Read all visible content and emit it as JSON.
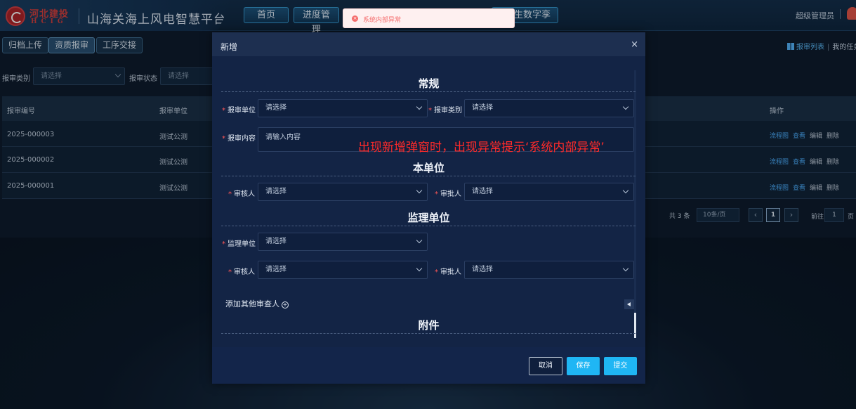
{
  "header": {
    "logo_cn": "河北建投",
    "logo_en": "HCIG",
    "app_title": "山海关海上风电智慧平台",
    "nav": {
      "home": "首页",
      "progress": "进度管理",
      "digital_twin": "孪生数字孪生"
    },
    "user": "超级管理员"
  },
  "subtabs": {
    "archive": "归档上传",
    "qualification": "资质报审",
    "handover": "工序交接"
  },
  "right_links": {
    "report_list": "报审列表",
    "my_tasks": "我的任务"
  },
  "filters": {
    "type_label": "报审类别",
    "type_placeholder": "请选择",
    "status_label": "报审状态",
    "status_placeholder": "请选择"
  },
  "table": {
    "headers": {
      "code": "报审编号",
      "unit": "报审单位",
      "ops": "操作"
    },
    "rows": [
      {
        "code": "2025-000003",
        "unit": "测试公测"
      },
      {
        "code": "2025-000002",
        "unit": "测试公测"
      },
      {
        "code": "2025-000001",
        "unit": "测试公测"
      }
    ],
    "ops": {
      "flow": "流程图",
      "view": "查看",
      "edit": "编辑",
      "delete": "删除"
    }
  },
  "pager": {
    "total": "共 3 条",
    "size": "10条/页",
    "current": "1",
    "goto": "前往",
    "goto_value": "1",
    "page": "页",
    "prev": "‹",
    "next": "›"
  },
  "dialog": {
    "title": "新增",
    "close": "×",
    "sections": {
      "general": "常规",
      "own_unit": "本单位",
      "supervision": "监理单位",
      "attachment": "附件"
    },
    "fields": {
      "report_unit": {
        "label": "报审单位",
        "placeholder": "请选择"
      },
      "report_type": {
        "label": "报审类别",
        "placeholder": "请选择"
      },
      "report_content": {
        "label": "报审内容",
        "placeholder": "请输入内容"
      },
      "own_reviewer": {
        "label": "审核人",
        "placeholder": "请选择"
      },
      "own_approver": {
        "label": "审批人",
        "placeholder": "请选择"
      },
      "sup_unit": {
        "label": "监理单位",
        "placeholder": "请选择"
      },
      "sup_reviewer": {
        "label": "审核人",
        "placeholder": "请选择"
      },
      "sup_approver": {
        "label": "审批人",
        "placeholder": "请选择"
      }
    },
    "required_mark": "*",
    "add_reviewer": "添加其他审查人",
    "buttons": {
      "cancel": "取消",
      "save": "保存",
      "submit": "提交"
    }
  },
  "toast": {
    "icon": "×",
    "message": "系统内部异常",
    "color": "#f56c6c"
  },
  "annotation": "出现新增弹窗时，出现异常提示‘系统内部异常’",
  "colors": {
    "accent": "#1fb6f4",
    "link": "#4db0ff",
    "required": "#ff5757",
    "annotation": "#ff2a2a"
  }
}
